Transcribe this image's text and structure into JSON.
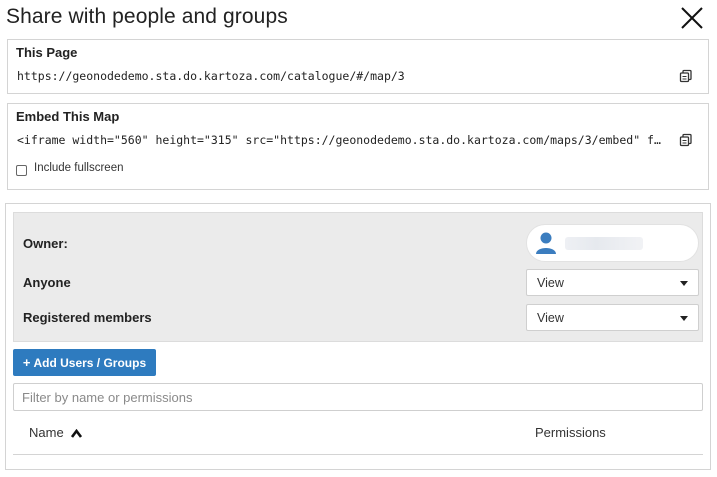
{
  "dialog": {
    "title": "Share with people and groups"
  },
  "this_page": {
    "title": "This Page",
    "url": "https://geonodedemo.sta.do.kartoza.com/catalogue/#/map/3"
  },
  "embed": {
    "title": "Embed This Map",
    "code": "<iframe width=\"560\" height=\"315\" src=\"https://geonodedemo.sta.do.kartoza.com/maps/3/embed\" f…",
    "include_fullscreen_label": "Include fullscreen",
    "include_fullscreen_checked": false
  },
  "permissions": {
    "owner_label": "Owner:",
    "anyone_label": "Anyone",
    "anyone_value": "View",
    "registered_label": "Registered members",
    "registered_value": "View",
    "add_button_label": "Add Users / Groups",
    "filter_placeholder": "Filter by name or permissions",
    "columns": {
      "name": "Name",
      "permissions": "Permissions"
    }
  },
  "colors": {
    "accent": "#2e7bbf",
    "panel_bg": "#ebebeb"
  },
  "icons": {
    "close": "close-icon",
    "copy": "copy-icon",
    "avatar": "user-avatar-icon",
    "sort": "sort-ascending-icon",
    "plus": "plus-icon"
  }
}
